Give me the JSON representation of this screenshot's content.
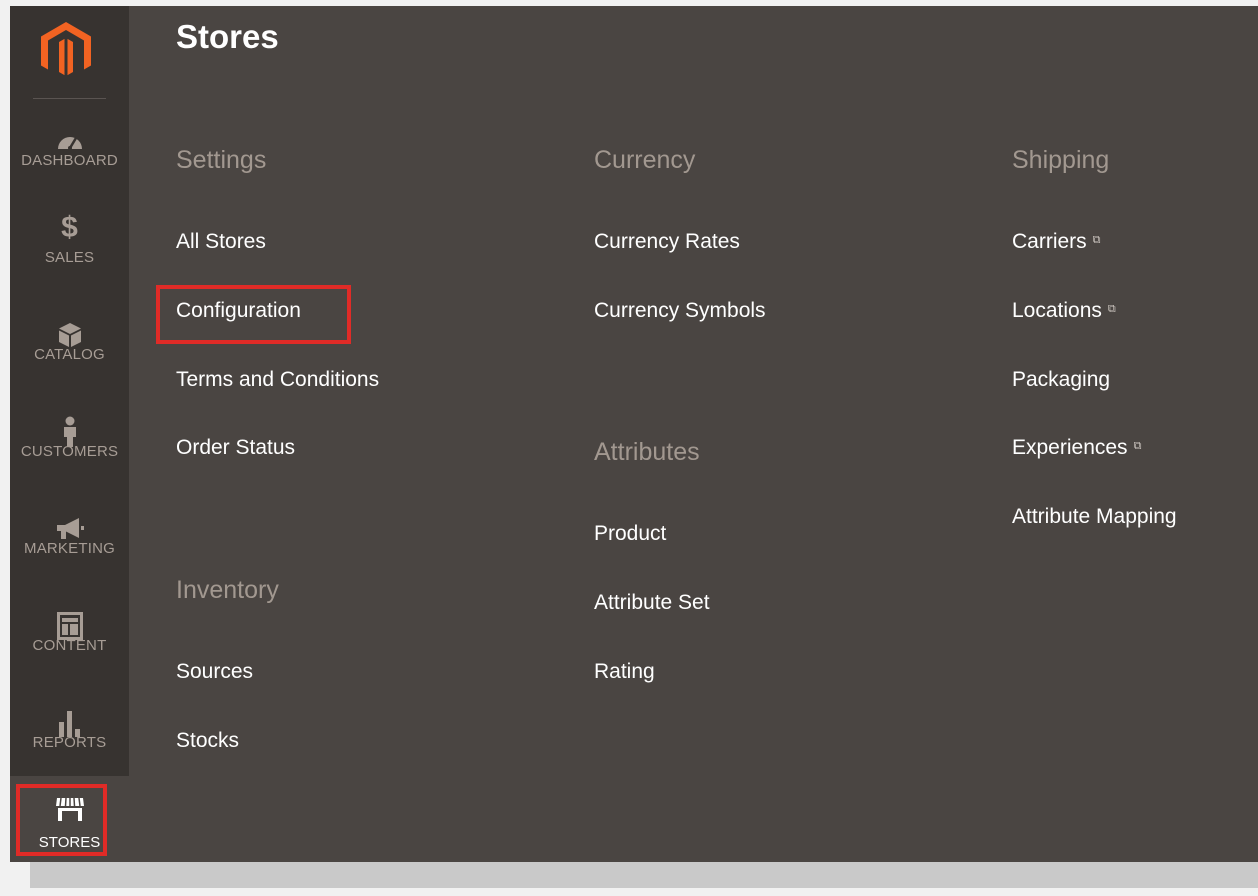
{
  "sidebar": {
    "logo_icon": "magento-logo-icon",
    "items": [
      {
        "label": "DASHBOARD",
        "icon": "dashboard-icon"
      },
      {
        "label": "SALES",
        "icon": "dollar-icon"
      },
      {
        "label": "CATALOG",
        "icon": "cube-icon"
      },
      {
        "label": "CUSTOMERS",
        "icon": "person-icon"
      },
      {
        "label": "MARKETING",
        "icon": "megaphone-icon"
      },
      {
        "label": "CONTENT",
        "icon": "layout-icon"
      },
      {
        "label": "REPORTS",
        "icon": "bar-chart-icon"
      }
    ],
    "active": {
      "label": "STORES",
      "icon": "storefront-icon"
    }
  },
  "page": {
    "title": "Stores"
  },
  "columns": {
    "settings": {
      "title": "Settings",
      "links": [
        "All Stores",
        "Configuration",
        "Terms and Conditions",
        "Order Status"
      ]
    },
    "inventory": {
      "title": "Inventory",
      "links": [
        "Sources",
        "Stocks"
      ]
    },
    "currency": {
      "title": "Currency",
      "links": [
        "Currency Rates",
        "Currency Symbols"
      ]
    },
    "attributes": {
      "title": "Attributes",
      "links": [
        "Product",
        "Attribute Set",
        "Rating"
      ]
    },
    "shipping": {
      "title": "Shipping",
      "links": [
        "Carriers",
        "Locations",
        "Packaging",
        "Experiences",
        "Attribute Mapping"
      ]
    }
  },
  "ext_icon": "⧉",
  "colors": {
    "highlight": "#e02b27",
    "accent_logo": "#f26322"
  }
}
